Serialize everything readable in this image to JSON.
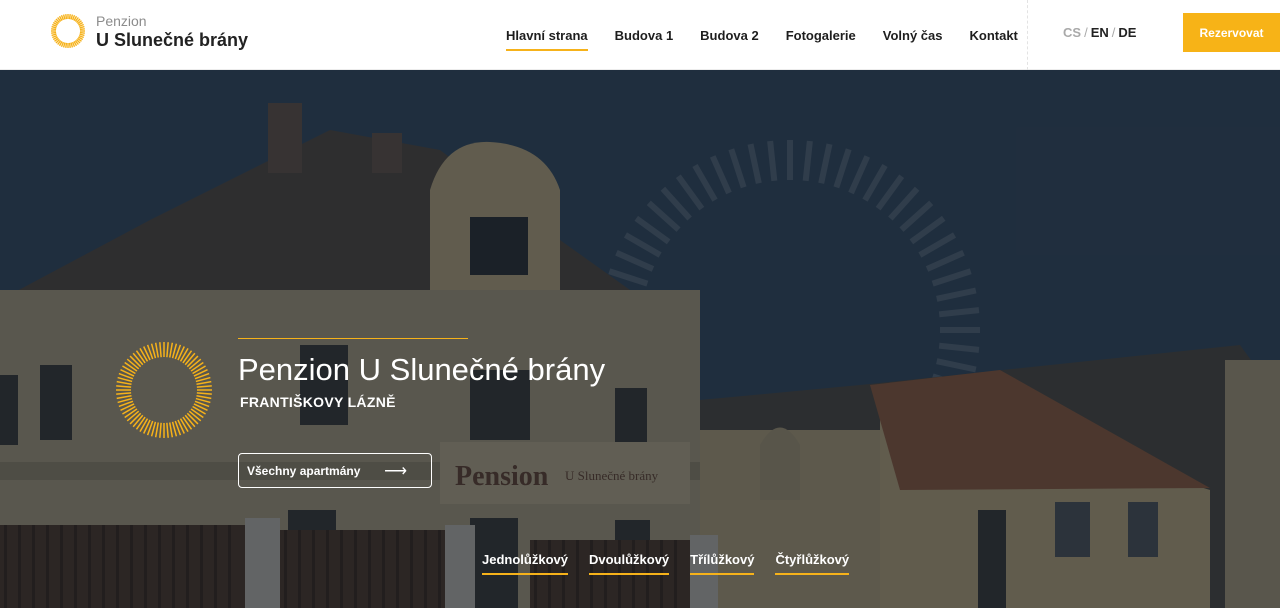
{
  "header": {
    "logo_small": "Penzion",
    "logo_big": "U Slunečné brány",
    "nav": [
      {
        "label": "Hlavní strana",
        "active": true
      },
      {
        "label": "Budova 1"
      },
      {
        "label": "Budova 2"
      },
      {
        "label": "Fotogalerie"
      },
      {
        "label": "Volný čas"
      },
      {
        "label": "Kontakt"
      }
    ],
    "languages": [
      "CS",
      "EN",
      "DE"
    ],
    "separator": "/",
    "reserve_label": "Rezervovat"
  },
  "hero": {
    "title": "Penzion U Slunečné brány",
    "subtitle": "FRANTIŠKOVY LÁZNĚ",
    "button_label": "Všechny apartmány",
    "button_arrow": "⟶",
    "room_links": [
      "Jednolůžkový",
      "Dvoulůžkový",
      "Třílůžkový",
      "Čtyřlůžkový"
    ],
    "sign_text": "Pension",
    "sign_text_2": "U Slunečné brány"
  },
  "colors": {
    "accent": "#f7b317",
    "text_dark": "#1e1e1e",
    "muted": "#a9a9a9"
  },
  "icons": {
    "logo": "sun-ring-icon",
    "arrow": "arrow-right-icon"
  }
}
